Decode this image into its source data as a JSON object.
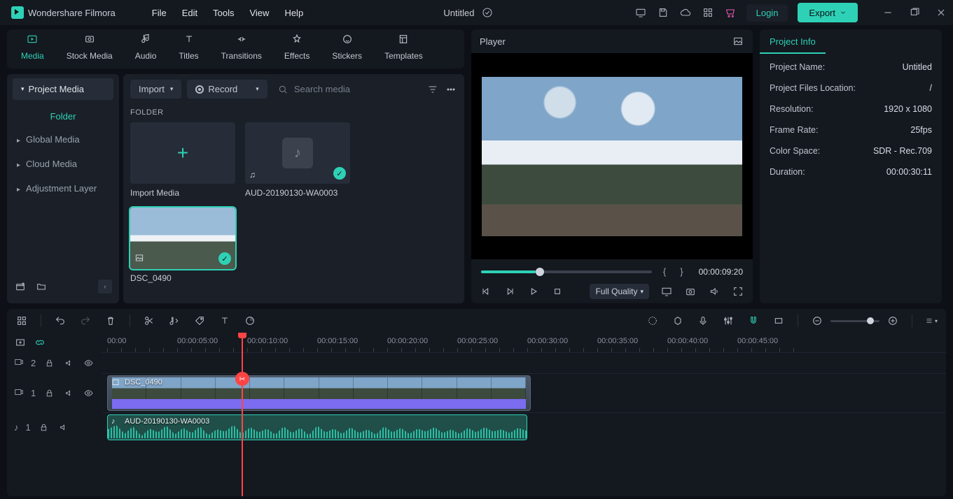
{
  "app_name": "Wondershare Filmora",
  "menu": [
    "File",
    "Edit",
    "Tools",
    "View",
    "Help"
  ],
  "project_title": "Untitled",
  "titlebar": {
    "login": "Login",
    "export": "Export"
  },
  "ribbon": [
    {
      "id": "media",
      "label": "Media"
    },
    {
      "id": "stock",
      "label": "Stock Media"
    },
    {
      "id": "audio",
      "label": "Audio"
    },
    {
      "id": "titles",
      "label": "Titles"
    },
    {
      "id": "trans",
      "label": "Transitions"
    },
    {
      "id": "effects",
      "label": "Effects"
    },
    {
      "id": "stickers",
      "label": "Stickers"
    },
    {
      "id": "templates",
      "label": "Templates"
    }
  ],
  "sidebar": {
    "project_media": "Project Media",
    "folder": "Folder",
    "items": [
      "Global Media",
      "Cloud Media",
      "Adjustment Layer"
    ]
  },
  "media_toolbar": {
    "import": "Import",
    "record": "Record",
    "search_placeholder": "Search media"
  },
  "media_folder_header": "FOLDER",
  "thumbs": [
    {
      "id": "import",
      "label": "Import Media",
      "type": "add"
    },
    {
      "id": "aud",
      "label": "AUD-20190130-WA0003",
      "type": "audio"
    },
    {
      "id": "dsc",
      "label": "DSC_0490",
      "type": "image",
      "active": true
    }
  ],
  "player": {
    "title": "Player",
    "timecode": "00:00:09:20",
    "quality": "Full Quality"
  },
  "info": {
    "tab": "Project Info",
    "rows": [
      {
        "k": "Project Name:",
        "v": "Untitled"
      },
      {
        "k": "Project Files Location:",
        "v": "/"
      },
      {
        "k": "Resolution:",
        "v": "1920 x 1080"
      },
      {
        "k": "Frame Rate:",
        "v": "25fps"
      },
      {
        "k": "Color Space:",
        "v": "SDR - Rec.709"
      },
      {
        "k": "Duration:",
        "v": "00:00:30:11"
      }
    ]
  },
  "ruler": [
    "00:00",
    "00:00:05:00",
    "00:00:10:00",
    "00:00:15:00",
    "00:00:20:00",
    "00:00:25:00",
    "00:00:30:00",
    "00:00:35:00",
    "00:00:40:00",
    "00:00:45:00"
  ],
  "tracks": {
    "v2": "2",
    "v1": "1",
    "a1": "1",
    "clip_video": "DSC_0490",
    "clip_audio": "AUD-20190130-WA0003"
  }
}
